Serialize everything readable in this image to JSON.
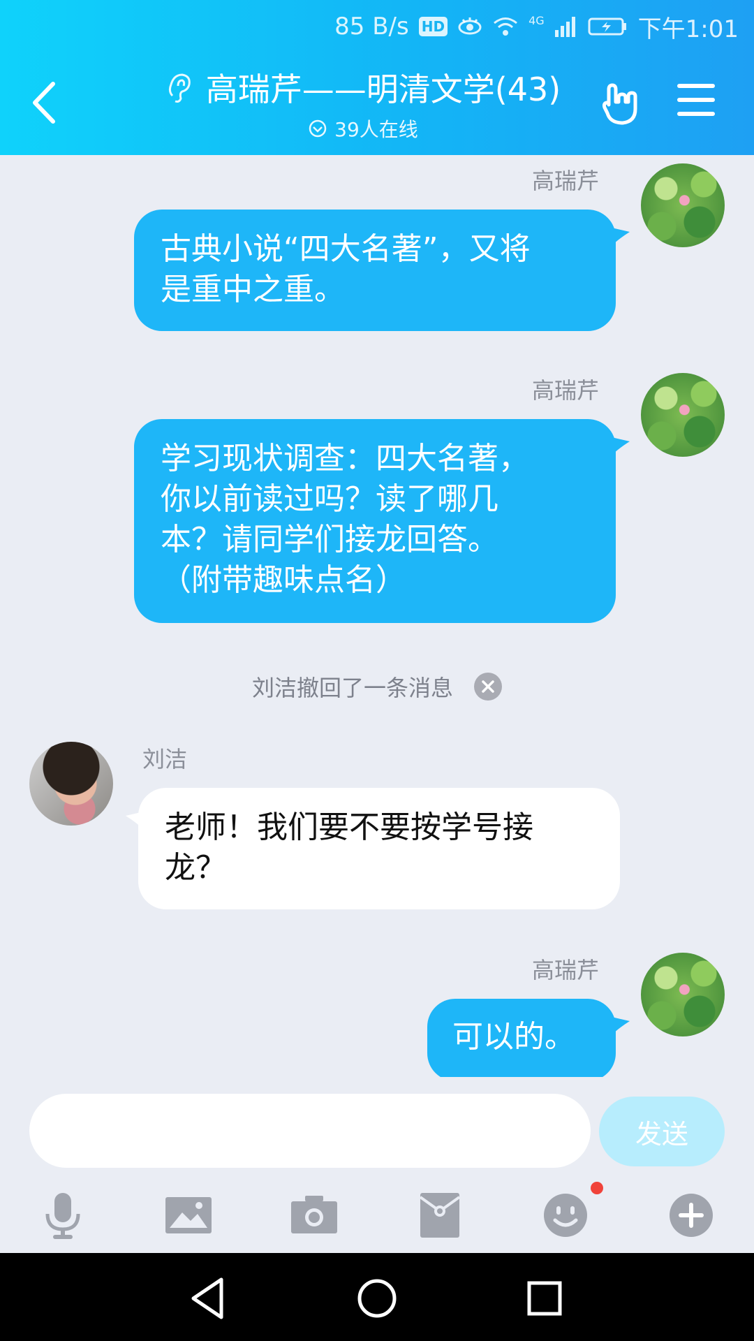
{
  "status_bar": {
    "net_speed": "85 B/s",
    "hd": "HD",
    "network": "4G",
    "time": "下午1:01"
  },
  "header": {
    "title": "高瑞芹——明清文学(43)",
    "online": "39人在线",
    "icons": [
      "back-icon",
      "ear-icon",
      "hand-gesture-icon",
      "menu-icon"
    ]
  },
  "messages": [
    {
      "sender": "高瑞芹",
      "text": "古典小说“四大名著”，又将是重中之重。",
      "line1": "古典小说“四大名著”，又将",
      "line2": "是重中之重。"
    },
    {
      "sender": "高瑞芹",
      "line1": "学习现状调查：四大名著，",
      "line2": "你以前读过吗？读了哪几",
      "line3": "本？请同学们接龙回答。",
      "line4": "（附带趣味点名）"
    },
    {
      "system": "刘洁撤回了一条消息"
    },
    {
      "sender": "刘洁",
      "line1": "老师！我们要不要按学号接",
      "line2": "龙？"
    },
    {
      "sender": "高瑞芹",
      "text": "可以的。"
    }
  ],
  "input": {
    "placeholder": "",
    "send_label": "发送"
  },
  "toolbar": [
    "microphone-icon",
    "image-icon",
    "camera-icon",
    "red-packet-icon",
    "emoji-icon",
    "plus-icon"
  ],
  "colors": {
    "header_start": "#0fd2fb",
    "header_end": "#1ea0f3",
    "bubble_out": "#1eb6f8",
    "send_button": "#b7edfd",
    "notification_dot": "#f0433a"
  }
}
